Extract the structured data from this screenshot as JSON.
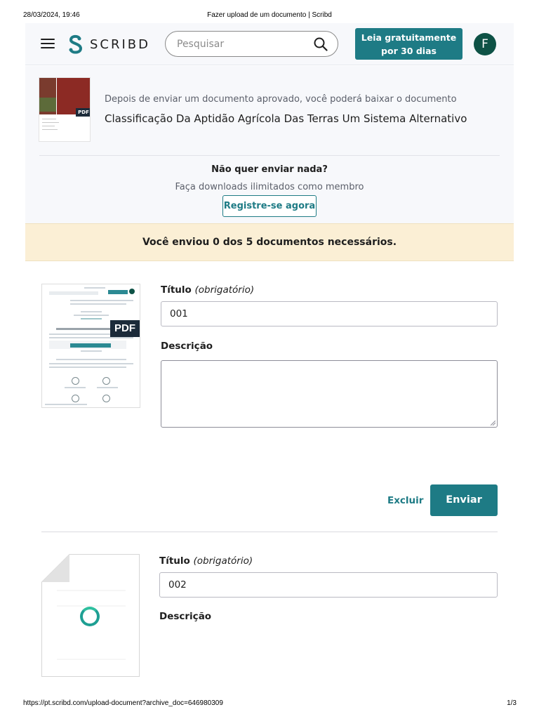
{
  "print_header": {
    "datetime": "28/03/2024, 19:46",
    "title": "Fazer upload de um documento | Scribd"
  },
  "print_footer": {
    "url": "https://pt.scribd.com/upload-document?archive_doc=646980309",
    "page": "1/3"
  },
  "header": {
    "logo_text": "SCRIBD",
    "search_placeholder": "Pesquisar",
    "cta_line1": "Leia gratuitamente",
    "cta_line2": "por 30 dias",
    "avatar_initial": "F",
    "brand_color": "#1e7b85"
  },
  "info": {
    "subtitle": "Depois de enviar um documento aprovado, você poderá baixar o documento",
    "document_title": "Classificação Da Aptidão Agrícola Das Terras Um Sistema Alternativo",
    "thumb_badge": "PDF",
    "no_send_heading": "Não quer enviar nada?",
    "downloads_text": "Faça downloads ilimitados como membro",
    "register_button": "Registre-se agora"
  },
  "alert": {
    "text": "Você enviou 0 dos 5 documentos necessários."
  },
  "uploads": [
    {
      "badge": "PDF",
      "title_label": "Título",
      "title_required": "(obrigatório)",
      "title_value": "001",
      "description_label": "Descrição",
      "description_value": "",
      "delete_label": "Excluir",
      "submit_label": "Enviar"
    },
    {
      "title_label": "Título",
      "title_required": "(obrigatório)",
      "title_value": "002",
      "description_label": "Descrição"
    }
  ]
}
